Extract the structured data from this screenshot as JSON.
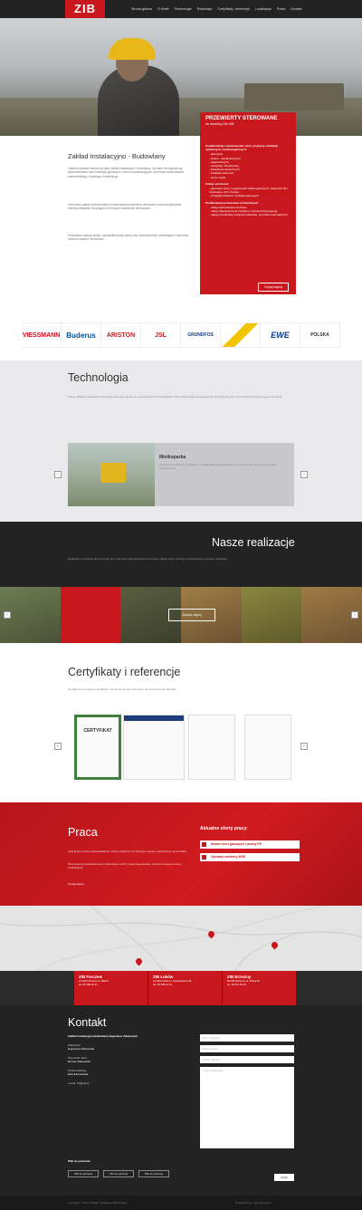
{
  "nav": {
    "logo": "ZIB",
    "items": [
      "Strona główna",
      "O firmie",
      "Technologie",
      "Realizacje",
      "Certyfikaty i referencje",
      "Lokalizacje",
      "Praca",
      "Kontakt"
    ]
  },
  "hero": {
    "caption_title": "PRZEWIERTY STEROWANE",
    "caption_sub": "do średnicy DN 400",
    "intro": "Projektowanie i wykonawstwo sieci, przyłączy, instalacji sanitarnych i technologicznych:",
    "list1": [
      "gazowych,",
      "wodno - kanalizacyjnych,",
      "ciepłowniczych,",
      "wentylacji i klimatyzacji,",
      "kolektorów słonecznych,",
      "instalacji solarnych,",
      "pomp ciepła"
    ],
    "serv_head": "Usługi serwisowe:",
    "list2": [
      "gazowych piecy i pogazowych kotłów gazowych i olejowych firm Viessmann, ACV, Ariston,",
      "przeglądy kotłowni i instalacji gazowych."
    ],
    "prod_head": "Prefabrykacja przewodów ciśnieniowych:",
    "list3": [
      "usługi wykonawstwa sieciowe,",
      "usługi zabezpieczenia przyłączy metodą bezwykopową,",
      "usługi przewiertów, kolejowe kabelowe, przeciski pneumatyczne."
    ],
    "cta": "Czytaj więcej"
  },
  "about": {
    "title": "Zakład Instalacyjno - Budowlany",
    "p1": "Zakład prywatnie utworzony jako zakład instalacyjny i budowlany. Od wielu lat zajmuje się wykonawstwem sieci instalacji gazowych i wodno-kanalizacyjnych na terenie województwa mazowieckiego, łódzkiego i lubelskiego.",
    "p2": "Generalny zakład profesjonalnie przeprowadza przewierty sterowane oraz bezwykopowe metody układania rurociągów w trudnych warunkach terenowych.",
    "p3": "Posiadamy własny sprzęt, wykwalifikowaną kadrę oraz doświadczenie pozwalające realizować zlecenia szybko i terminowo."
  },
  "logos": [
    "VIESSMANN",
    "Buderus",
    "ARISTON",
    "JSL",
    "GRUNDFOS",
    "",
    "EWE",
    "POLSKA"
  ],
  "tech": {
    "title": "Technologia",
    "text": "Usługi Zakładu Instalacyjno-Budowlanego opierają się na nowoczesnych technologiach, które zapewniają wysoką jakość wykonanych prac oraz minimalną ingerencję w otoczenie.",
    "slide_title": "Minikoparka",
    "slide_desc": "Nowoczesne koparki z gąsienicami, umożliwiające wykonywanie precyzyjnych prac ziemnych w ciasnych przestrzeniach."
  },
  "real": {
    "title": "Nasze realizacje",
    "text": "Realizujemy zlecenia dla instytucji, firm i klientów indywidualnych na terenie całego kraju. Poniżej przedstawiamy wybrane realizacje.",
    "button": "Zobacz więcej"
  },
  "cert": {
    "title": "Certyfikaty i referencje",
    "text": "Posiadamy wymagane certyfikaty i uprawnienia oraz referencje od zadowolonych klientów.",
    "cert_label": "CERTYFIKAT"
  },
  "praca": {
    "title": "Praca",
    "p1": "Jeśli jesteś osobą odpowiedzialną i chcesz dołączyć do naszego zespołu, zapraszamy do kontaktu.",
    "p2": "Poszukujemy doświadczonych fachowców, którzy dysponują wiedzą i chęcią rozwoju w branży instalacyjnej.",
    "more": "Czytaj więcej",
    "offers_title": "Aktualne oferty pracy:",
    "offers": [
      "Monter sieci gazowych i wodny PE",
      "Operator wiertnicy HDD"
    ]
  },
  "offices": [
    {
      "name": "ZIB Parczew",
      "addr": "21-200 Parczew ul. Mała 8",
      "phone": "tel. 83 355 23 41"
    },
    {
      "name": "ZIB Łuków",
      "addr": "21-400 Łuków ul. Sienkiewicza 46",
      "phone": "tel. 25 798 12 34"
    },
    {
      "name": "ZIB Brzeziny",
      "addr": "95-060 Brzeziny ul. Polna 50",
      "phone": "tel. 46 874 05 23"
    }
  ],
  "contact": {
    "title": "Kontakt",
    "company": "Zakład Instalacyjno-Budowlany Eugeniusz Zdanowski",
    "l1": "Właściciel:",
    "n1": "Eugeniusz Zdanowski",
    "l2": "Kierownik robót:",
    "n2": "Roman Zdanowski",
    "l3": "Dział handlowy:",
    "n3": "Ewa Zdanowska",
    "email": "e-mail: zib@zib.pl",
    "files_title": "Pliki do pobrania:",
    "files": [
      "Plik do pobrania",
      "Plik do pobrania",
      "Plik do pobrania"
    ],
    "fields": [
      "Imię i nazwisko",
      "Adres e-mail",
      "Numer telefonu",
      "Treść wiadomości"
    ],
    "send": "Wyślij"
  },
  "footer": {
    "left": "Copyright © 2017 Zakład Instalacyjno-Budowlany",
    "right": "Projekt strony: Internet Group"
  }
}
